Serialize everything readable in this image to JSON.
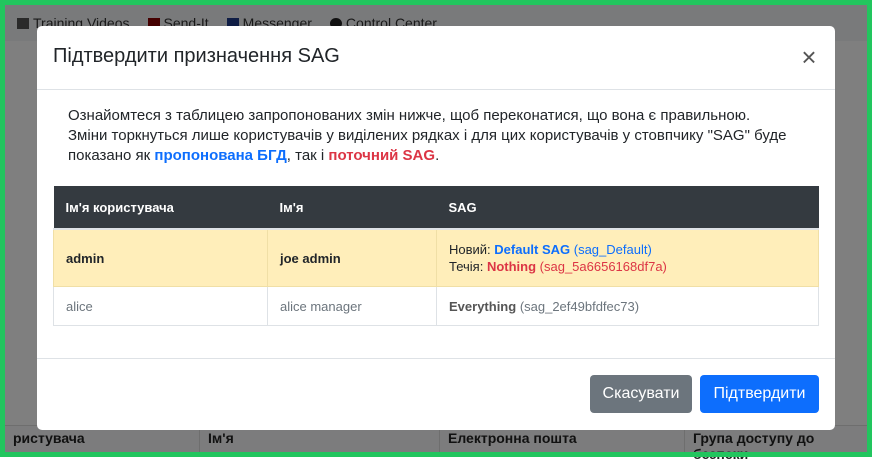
{
  "background": {
    "nav": [
      "Training Videos",
      "Send-It",
      "Messenger",
      "Control Center"
    ],
    "table_headers": [
      "ристувача",
      "Ім'я",
      "Електронна пошта",
      "Група доступу до безпеки"
    ]
  },
  "modal": {
    "title": "Підтвердити призначення SAG",
    "close_label": "×",
    "intro_1": "Ознайомтеся з таблицею запропонованих змін нижче, щоб переконатися, що вона є правильною. Зміни торкнуться лише користувачів у виділених рядках і для цих користувачів у стовпчику \"SAG\" буде показано як ",
    "intro_blue": "пропонована БГД",
    "intro_2": ", так і ",
    "intro_red": "поточний SAG",
    "intro_3": ".",
    "table": {
      "headers": [
        "Ім'я користувача",
        "Ім'я",
        "SAG"
      ],
      "rows": [
        {
          "username": "admin",
          "name": "joe admin",
          "new_label": "Новий: ",
          "new_value": "Default SAG",
          "new_id": "(sag_Default)",
          "current_label": "Течія: ",
          "current_value": "Nothing",
          "current_id": "(sag_5a6656168df7a)"
        },
        {
          "username": "alice",
          "name": "alice manager",
          "sag_value": "Everything",
          "sag_id": "(sag_2ef49bfdfec73)"
        }
      ]
    },
    "cancel_label": "Скасувати",
    "confirm_label": "Підтвердити"
  }
}
